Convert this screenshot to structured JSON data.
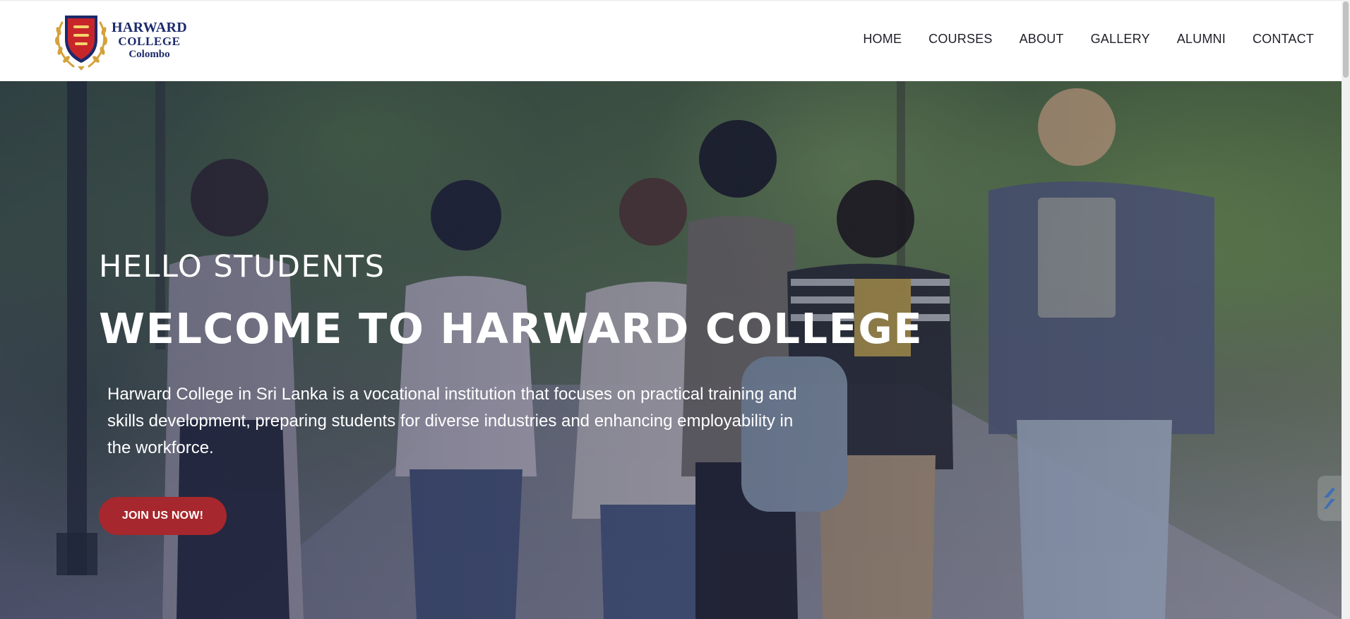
{
  "logo": {
    "line1": "HARWARD",
    "line2": "COLLEGE",
    "line3": "Colombo",
    "colors": {
      "navy": "#1c2a6b",
      "red": "#c8252b",
      "gold": "#d4a23a"
    }
  },
  "nav": {
    "items": [
      {
        "label": "HOME"
      },
      {
        "label": "COURSES"
      },
      {
        "label": "ABOUT"
      },
      {
        "label": "GALLERY"
      },
      {
        "label": "ALUMNI"
      },
      {
        "label": "CONTACT"
      }
    ]
  },
  "hero": {
    "eyebrow": "HELLO STUDENTS",
    "title": "WELCOME TO HARWARD COLLEGE",
    "description": "Harward College in Sri Lanka is a vocational institution that focuses on practical training and skills development, preparing students for diverse industries and enhancing employability in the workforce.",
    "cta_label": "JOIN US NOW!",
    "cta_color": "#a6272d"
  }
}
